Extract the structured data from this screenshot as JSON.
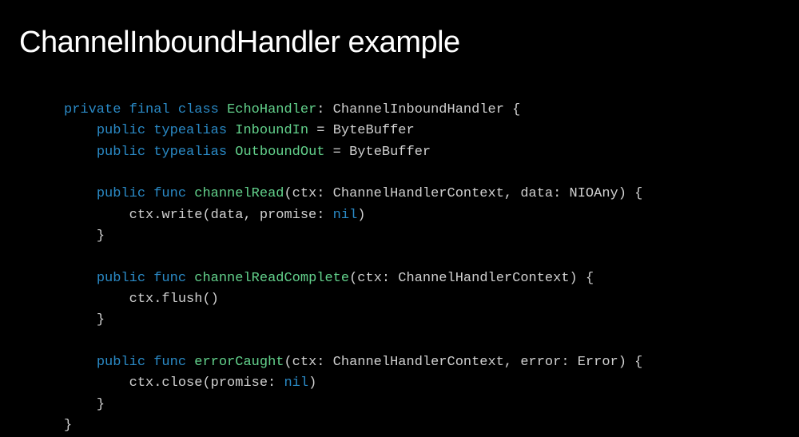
{
  "title": "ChannelInboundHandler example",
  "code": {
    "line1_kw1": "private",
    "line1_kw2": "final",
    "line1_kw3": "class",
    "line1_name": "EchoHandler",
    "line1_rest": ": ChannelInboundHandler {",
    "line2_kw1": "public",
    "line2_kw2": "typealias",
    "line2_name": "InboundIn",
    "line2_rest": " = ByteBuffer",
    "line3_kw1": "public",
    "line3_kw2": "typealias",
    "line3_name": "OutboundOut",
    "line3_rest": " = ByteBuffer",
    "line5_kw1": "public",
    "line5_kw2": "func",
    "line5_name": "channelRead",
    "line5_rest": "(ctx: ChannelHandlerContext, data: NIOAny) {",
    "line6_text": "ctx.write(data, promise: ",
    "line6_nil": "nil",
    "line6_close": ")",
    "line7_brace": "}",
    "line9_kw1": "public",
    "line9_kw2": "func",
    "line9_name": "channelReadComplete",
    "line9_rest": "(ctx: ChannelHandlerContext) {",
    "line10_text": "ctx.flush()",
    "line11_brace": "}",
    "line13_kw1": "public",
    "line13_kw2": "func",
    "line13_name": "errorCaught",
    "line13_rest": "(ctx: ChannelHandlerContext, error: Error) {",
    "line14_text": "ctx.close(promise: ",
    "line14_nil": "nil",
    "line14_close": ")",
    "line15_brace": "}",
    "line16_brace": "}"
  }
}
